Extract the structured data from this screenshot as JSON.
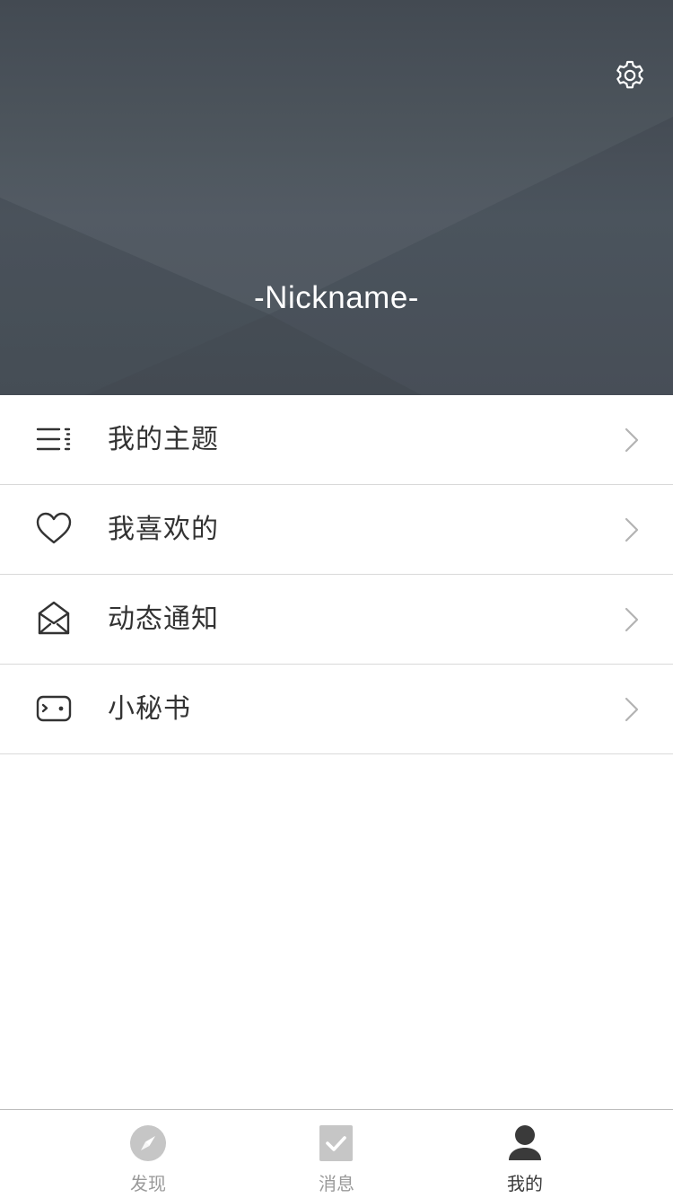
{
  "header": {
    "nickname": "-Nickname-",
    "settings_icon": "gear-icon",
    "colors": {
      "background_top": "#3f464e",
      "background_mid": "#4f5861",
      "text": "#ffffff"
    }
  },
  "menu": {
    "items": [
      {
        "label": "我的主题",
        "icon": "list-icon"
      },
      {
        "label": "我喜欢的",
        "icon": "heart-icon"
      },
      {
        "label": "动态通知",
        "icon": "envelope-open-icon"
      },
      {
        "label": "小秘书",
        "icon": "assistant-icon"
      }
    ],
    "chevron_icon": "chevron-right-icon"
  },
  "tabbar": {
    "tabs": [
      {
        "label": "发现",
        "icon": "compass-icon",
        "active": false
      },
      {
        "label": "消息",
        "icon": "checkbox-icon",
        "active": false
      },
      {
        "label": "我的",
        "icon": "user-icon",
        "active": true
      }
    ],
    "colors": {
      "inactive": "#9a9a9a",
      "active": "#3a3a3a"
    }
  }
}
